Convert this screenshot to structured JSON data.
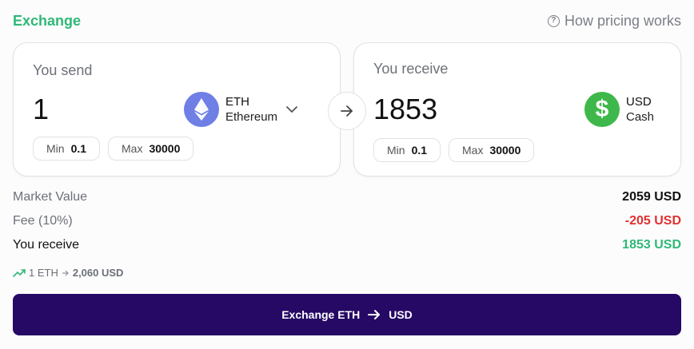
{
  "header": {
    "title": "Exchange",
    "pricing_link": "How pricing works",
    "pricing_icon": "help-circle-icon"
  },
  "send": {
    "label": "You send",
    "amount": "1",
    "currency_code": "ETH",
    "currency_name": "Ethereum",
    "icon": "ethereum-icon",
    "min_label": "Min",
    "min_value": "0.1",
    "max_label": "Max",
    "max_value": "30000"
  },
  "receive": {
    "label": "You receive",
    "amount": "1853",
    "currency_code": "USD",
    "currency_name": "Cash",
    "icon": "dollar-icon",
    "min_label": "Min",
    "min_value": "0.1",
    "max_label": "Max",
    "max_value": "30000"
  },
  "summary": {
    "market_label": "Market Value",
    "market_value": "2059 USD",
    "fee_label": "Fee (10%)",
    "fee_value": "-205 USD",
    "receive_label": "You receive",
    "receive_value": "1853 USD"
  },
  "rate": {
    "from": "1 ETH",
    "to": "2,060 USD"
  },
  "cta": {
    "from": "Exchange ETH",
    "to": "USD"
  },
  "colors": {
    "accent_green": "#2fb877",
    "fee_red": "#e03131",
    "cta_bg": "#260865",
    "eth_coin": "#6f7fe6",
    "usd_coin": "#3eb84a"
  }
}
